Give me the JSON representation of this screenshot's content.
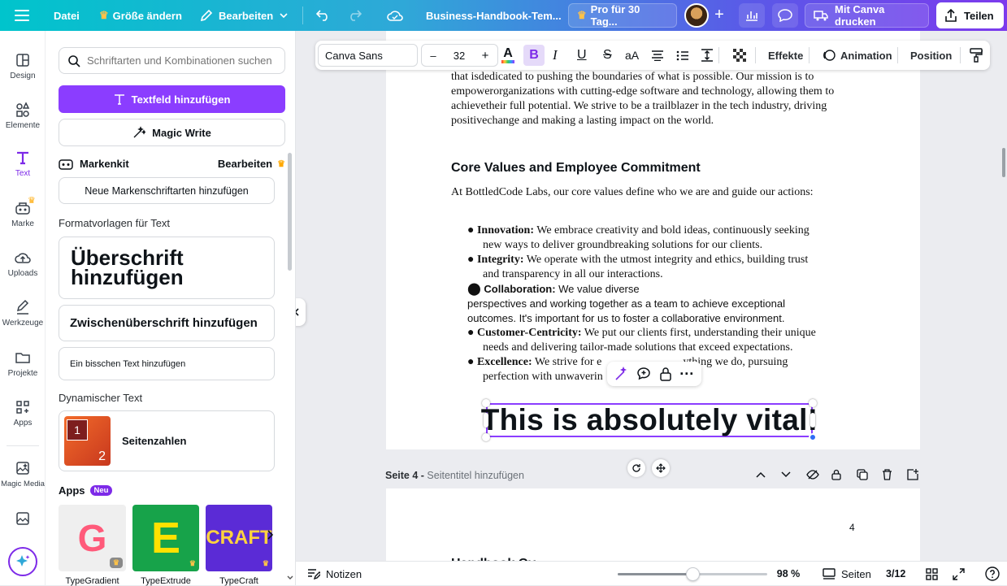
{
  "topbar": {
    "file": "Datei",
    "resize": "Größe ändern",
    "edit": "Bearbeiten",
    "doc_title": "Business-Handbook-Tem...",
    "pro_trial": "Pro für 30 Tag...",
    "print": "Mit Canva drucken",
    "share": "Teilen"
  },
  "rail": {
    "items": [
      {
        "label": "Design",
        "icon": "layout-icon"
      },
      {
        "label": "Elemente",
        "icon": "shapes-icon"
      },
      {
        "label": "Text",
        "icon": "text-icon"
      },
      {
        "label": "Marke",
        "icon": "brand-icon"
      },
      {
        "label": "Uploads",
        "icon": "cloud-upload-icon"
      },
      {
        "label": "Werkzeuge",
        "icon": "draw-icon"
      },
      {
        "label": "Projekte",
        "icon": "folder-icon"
      },
      {
        "label": "Apps",
        "icon": "apps-icon"
      },
      {
        "label": "Magic Media",
        "icon": "magic-media-icon"
      }
    ]
  },
  "panel": {
    "search_placeholder": "Schriftarten und Kombinationen suchen",
    "add_textbox": "Textfeld hinzufügen",
    "magic_write": "Magic Write",
    "brand_kit": "Markenkit",
    "brand_edit": "Bearbeiten",
    "add_brand_fonts": "Neue Markenschriftarten hinzufügen",
    "text_styles_heading": "Formatvorlagen für Text",
    "heading_style": "Überschrift hinzufügen",
    "subheading_style": "Zwischenüberschrift hinzufügen",
    "body_style": "Ein bisschen Text hinzufügen",
    "dynamic_heading": "Dynamischer Text",
    "page_numbers": "Seitenzahlen",
    "page_numbers_badge": "1",
    "page_numbers_badge2": "2",
    "apps_heading": "Apps",
    "apps_new": "Neu",
    "apps": [
      "TypeGradient",
      "TypeExtrude",
      "TypeCraft"
    ],
    "app_thumb_letters": [
      "G",
      "E",
      "CRAFT"
    ]
  },
  "toolbar": {
    "font": "Canva Sans",
    "minus": "–",
    "size": "32",
    "plus": "+",
    "effects": "Effekte",
    "animation": "Animation",
    "position": "Position"
  },
  "page3": {
    "para": [
      "that isdedicated to pushing the boundaries of what is possible. Our mission is to",
      "empowerorganizations with cutting-edge software and technology, allowing them to",
      "achievetheir full potential. We strive to be a trailblazer in the tech industry, driving",
      "positivechange and making a lasting impact on the world."
    ],
    "heading": "Core Values and Employee Commitment",
    "intro": "At BottledCode Labs, our core values define who we are and guide our actions:",
    "bullets": [
      {
        "bold": "Innovation:",
        "rest": " We embrace creativity and bold ideas, continuously seeking",
        "cont": "new ways to deliver groundbreaking solutions for our clients."
      },
      {
        "bold": "Integrity:",
        "rest": " We operate with the utmost integrity and ethics, building trust",
        "cont": "and transparency in all our interactions."
      },
      {
        "bold": "Collaboration:",
        "rest": " We value diverse",
        "cont": "perspectives and working together as a team to achieve exceptional",
        "cont2": "outcomes. It's important for us to foster a collaborative environment."
      },
      {
        "bold": "Customer-Centricity:",
        "rest": " We put our clients first, understanding their unique",
        "cont": "needs and delivering tailor-made solutions that exceed expectations."
      },
      {
        "bold": "Excellence:",
        "rest": " We strive for e",
        "rest2": "ything we do, pursuing",
        "cont": "perfection with unwaverin"
      }
    ],
    "selected_text": "This is absolutely vital!"
  },
  "page4": {
    "label": "Seite 4 - ",
    "title_placeholder": "Seitentitel hinzufügen",
    "page_number": "4",
    "partial_heading": "Handbook Ov"
  },
  "bottombar": {
    "notes": "Notizen",
    "zoom": "98 %",
    "zoom_fraction": 0.5,
    "pages": "Seiten",
    "page_count": "3/12"
  },
  "colors": {
    "accent": "#7d2ae8",
    "brand_cyan": "#00c4cc"
  }
}
